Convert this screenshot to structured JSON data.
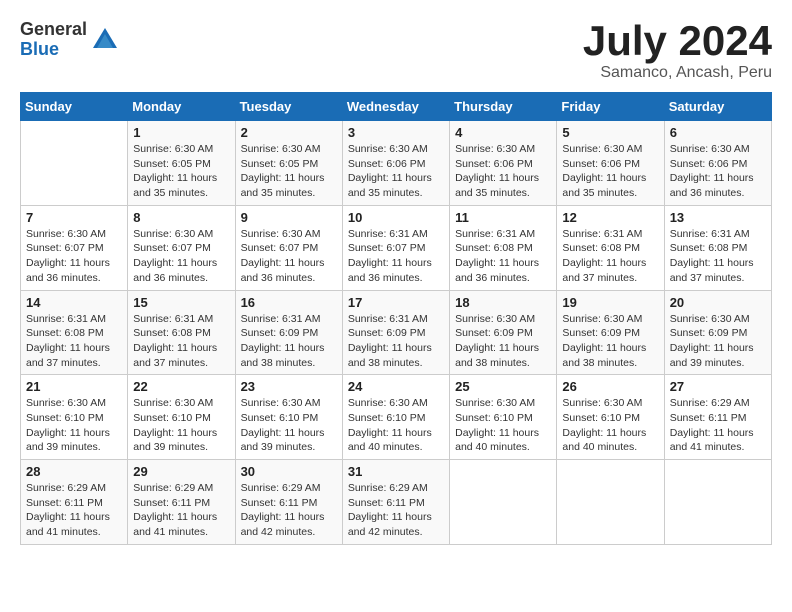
{
  "logo": {
    "general": "General",
    "blue": "Blue"
  },
  "title": "July 2024",
  "location": "Samanco, Ancash, Peru",
  "days_of_week": [
    "Sunday",
    "Monday",
    "Tuesday",
    "Wednesday",
    "Thursday",
    "Friday",
    "Saturday"
  ],
  "weeks": [
    [
      {
        "day": "",
        "info": ""
      },
      {
        "day": "1",
        "info": "Sunrise: 6:30 AM\nSunset: 6:05 PM\nDaylight: 11 hours\nand 35 minutes."
      },
      {
        "day": "2",
        "info": "Sunrise: 6:30 AM\nSunset: 6:05 PM\nDaylight: 11 hours\nand 35 minutes."
      },
      {
        "day": "3",
        "info": "Sunrise: 6:30 AM\nSunset: 6:06 PM\nDaylight: 11 hours\nand 35 minutes."
      },
      {
        "day": "4",
        "info": "Sunrise: 6:30 AM\nSunset: 6:06 PM\nDaylight: 11 hours\nand 35 minutes."
      },
      {
        "day": "5",
        "info": "Sunrise: 6:30 AM\nSunset: 6:06 PM\nDaylight: 11 hours\nand 35 minutes."
      },
      {
        "day": "6",
        "info": "Sunrise: 6:30 AM\nSunset: 6:06 PM\nDaylight: 11 hours\nand 36 minutes."
      }
    ],
    [
      {
        "day": "7",
        "info": "Sunrise: 6:30 AM\nSunset: 6:07 PM\nDaylight: 11 hours\nand 36 minutes."
      },
      {
        "day": "8",
        "info": "Sunrise: 6:30 AM\nSunset: 6:07 PM\nDaylight: 11 hours\nand 36 minutes."
      },
      {
        "day": "9",
        "info": "Sunrise: 6:30 AM\nSunset: 6:07 PM\nDaylight: 11 hours\nand 36 minutes."
      },
      {
        "day": "10",
        "info": "Sunrise: 6:31 AM\nSunset: 6:07 PM\nDaylight: 11 hours\nand 36 minutes."
      },
      {
        "day": "11",
        "info": "Sunrise: 6:31 AM\nSunset: 6:08 PM\nDaylight: 11 hours\nand 36 minutes."
      },
      {
        "day": "12",
        "info": "Sunrise: 6:31 AM\nSunset: 6:08 PM\nDaylight: 11 hours\nand 37 minutes."
      },
      {
        "day": "13",
        "info": "Sunrise: 6:31 AM\nSunset: 6:08 PM\nDaylight: 11 hours\nand 37 minutes."
      }
    ],
    [
      {
        "day": "14",
        "info": "Sunrise: 6:31 AM\nSunset: 6:08 PM\nDaylight: 11 hours\nand 37 minutes."
      },
      {
        "day": "15",
        "info": "Sunrise: 6:31 AM\nSunset: 6:08 PM\nDaylight: 11 hours\nand 37 minutes."
      },
      {
        "day": "16",
        "info": "Sunrise: 6:31 AM\nSunset: 6:09 PM\nDaylight: 11 hours\nand 38 minutes."
      },
      {
        "day": "17",
        "info": "Sunrise: 6:31 AM\nSunset: 6:09 PM\nDaylight: 11 hours\nand 38 minutes."
      },
      {
        "day": "18",
        "info": "Sunrise: 6:30 AM\nSunset: 6:09 PM\nDaylight: 11 hours\nand 38 minutes."
      },
      {
        "day": "19",
        "info": "Sunrise: 6:30 AM\nSunset: 6:09 PM\nDaylight: 11 hours\nand 38 minutes."
      },
      {
        "day": "20",
        "info": "Sunrise: 6:30 AM\nSunset: 6:09 PM\nDaylight: 11 hours\nand 39 minutes."
      }
    ],
    [
      {
        "day": "21",
        "info": "Sunrise: 6:30 AM\nSunset: 6:10 PM\nDaylight: 11 hours\nand 39 minutes."
      },
      {
        "day": "22",
        "info": "Sunrise: 6:30 AM\nSunset: 6:10 PM\nDaylight: 11 hours\nand 39 minutes."
      },
      {
        "day": "23",
        "info": "Sunrise: 6:30 AM\nSunset: 6:10 PM\nDaylight: 11 hours\nand 39 minutes."
      },
      {
        "day": "24",
        "info": "Sunrise: 6:30 AM\nSunset: 6:10 PM\nDaylight: 11 hours\nand 40 minutes."
      },
      {
        "day": "25",
        "info": "Sunrise: 6:30 AM\nSunset: 6:10 PM\nDaylight: 11 hours\nand 40 minutes."
      },
      {
        "day": "26",
        "info": "Sunrise: 6:30 AM\nSunset: 6:10 PM\nDaylight: 11 hours\nand 40 minutes."
      },
      {
        "day": "27",
        "info": "Sunrise: 6:29 AM\nSunset: 6:11 PM\nDaylight: 11 hours\nand 41 minutes."
      }
    ],
    [
      {
        "day": "28",
        "info": "Sunrise: 6:29 AM\nSunset: 6:11 PM\nDaylight: 11 hours\nand 41 minutes."
      },
      {
        "day": "29",
        "info": "Sunrise: 6:29 AM\nSunset: 6:11 PM\nDaylight: 11 hours\nand 41 minutes."
      },
      {
        "day": "30",
        "info": "Sunrise: 6:29 AM\nSunset: 6:11 PM\nDaylight: 11 hours\nand 42 minutes."
      },
      {
        "day": "31",
        "info": "Sunrise: 6:29 AM\nSunset: 6:11 PM\nDaylight: 11 hours\nand 42 minutes."
      },
      {
        "day": "",
        "info": ""
      },
      {
        "day": "",
        "info": ""
      },
      {
        "day": "",
        "info": ""
      }
    ]
  ]
}
